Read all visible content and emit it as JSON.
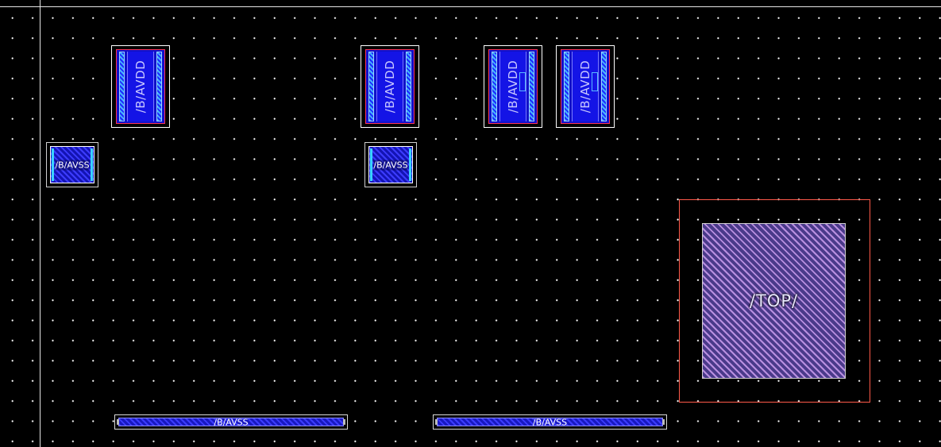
{
  "canvas": {
    "background": "#000000",
    "grid_dot_color": "#ffffff",
    "axis_color": "#e6e6e6"
  },
  "colors": {
    "metal_blue": "#1414e6",
    "via_cyan": "#46b4ff",
    "boundary_red": "#ff5a4a",
    "top_hatch": "#b98fe0"
  },
  "cells": {
    "avdd_label": "/B/AVDD",
    "avss_label": "/B/AVSS",
    "top_label": "/TOP/"
  },
  "avdd_cells": [
    {
      "label": "/B/AVDD"
    },
    {
      "label": "/B/AVDD"
    },
    {
      "label": "/B/AVDD"
    },
    {
      "label": "/B/AVDD"
    }
  ],
  "avss_cells": [
    {
      "label": "/B/AVSS"
    },
    {
      "label": "/B/AVSS"
    }
  ],
  "avss_rails": [
    {
      "label": "/B/AVSS"
    },
    {
      "label": "/B/AVSS"
    }
  ]
}
